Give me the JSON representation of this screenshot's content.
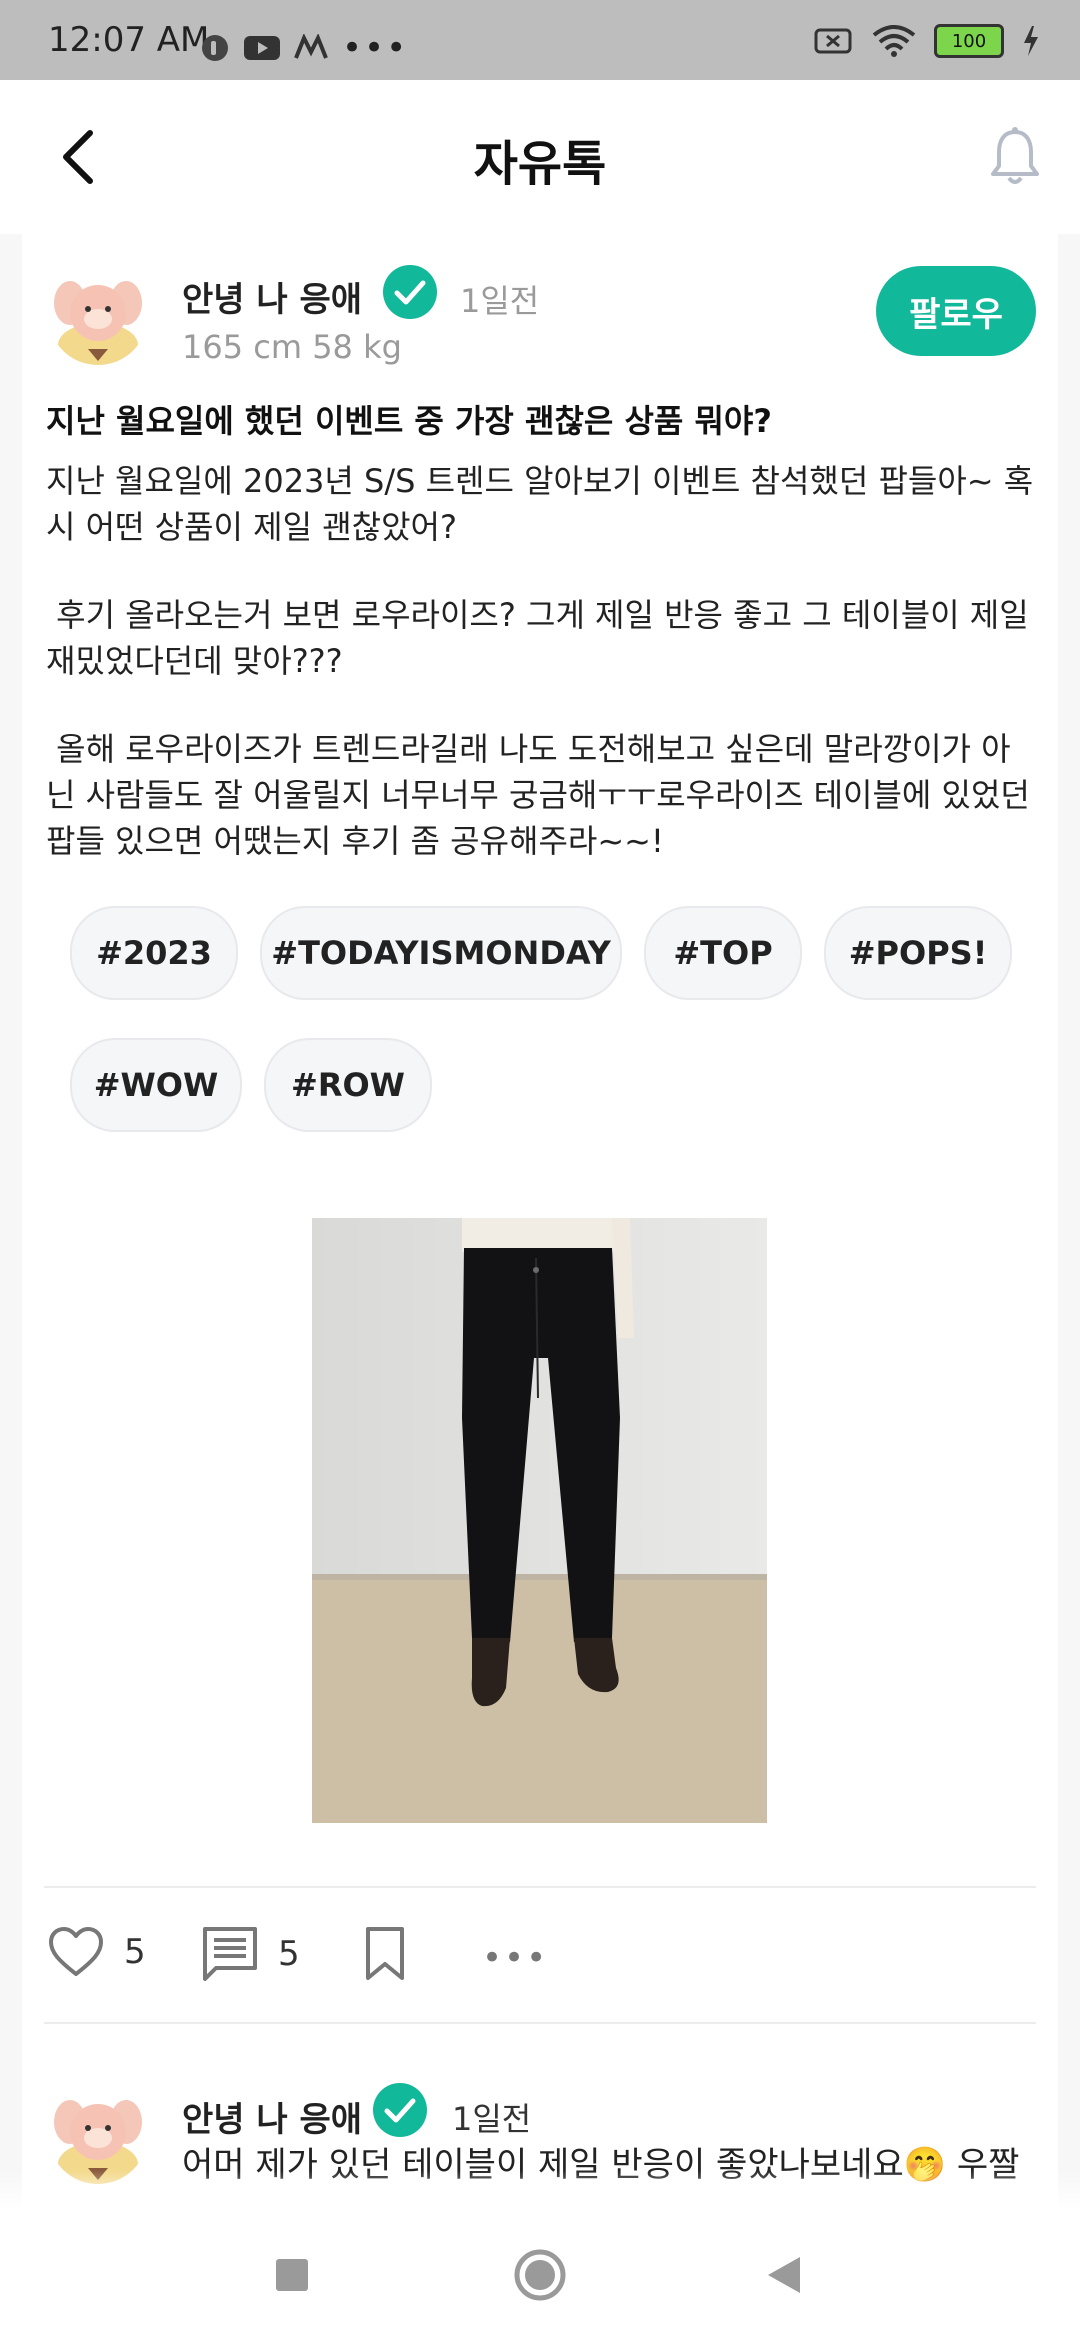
{
  "status_bar": {
    "time": "12:07 AM",
    "battery": "100",
    "more": "•••",
    "icons": [
      "app-icon",
      "youtube-icon",
      "m-app-icon",
      "battery-x-icon",
      "wifi-icon",
      "battery-icon",
      "charging-icon"
    ]
  },
  "header": {
    "title": "자유톡",
    "back_icon": "back-icon",
    "bell_icon": "bell-icon"
  },
  "post": {
    "author": {
      "name": "안녕 나 응애",
      "time_ago": "1일전",
      "meta": "165 cm 58 kg",
      "verified": true
    },
    "follow_label": "팔로우",
    "title": "지난 월요일에 했던 이벤트 중 가장 괜찮은 상품 뭐야?",
    "body": [
      "지난 월요일에 2023년 S/S 트렌드 알아보기 이벤트 참석했던 팝들아~ 혹시 어떤 상품이 제일 괜찮았어?",
      " 후기 올라오는거 보면 로우라이즈? 그게 제일 반응 좋고 그 테이블이 제일 재밌었다던데 맞아???",
      " 올해 로우라이즈가 트렌드라길래 나도 도전해보고 싶은데 말라깡이가 아닌 사람들도 잘 어울릴지 너무너무 궁금해ㅜㅜ로우라이즈 테이블에 있었던 팝들 있으면 어땠는지 후기 좀 공유해주라~~!"
    ],
    "hashtags": [
      "#2023",
      "#TODAYISMONDAY",
      "#TOP",
      "#POPS!",
      "#WOW",
      "#ROW"
    ],
    "image_label": "black-pants-photo",
    "likes": "5",
    "comments": "5",
    "more": "•••"
  },
  "comment": {
    "author": "안녕 나 응애",
    "time_ago": "1일전",
    "text": "어머 제가 있던 테이블이 제일 반응이 좋았나보네요🤭 우짤"
  },
  "colors": {
    "accent": "#12b89a",
    "status_bar": "#bdbdbd"
  }
}
